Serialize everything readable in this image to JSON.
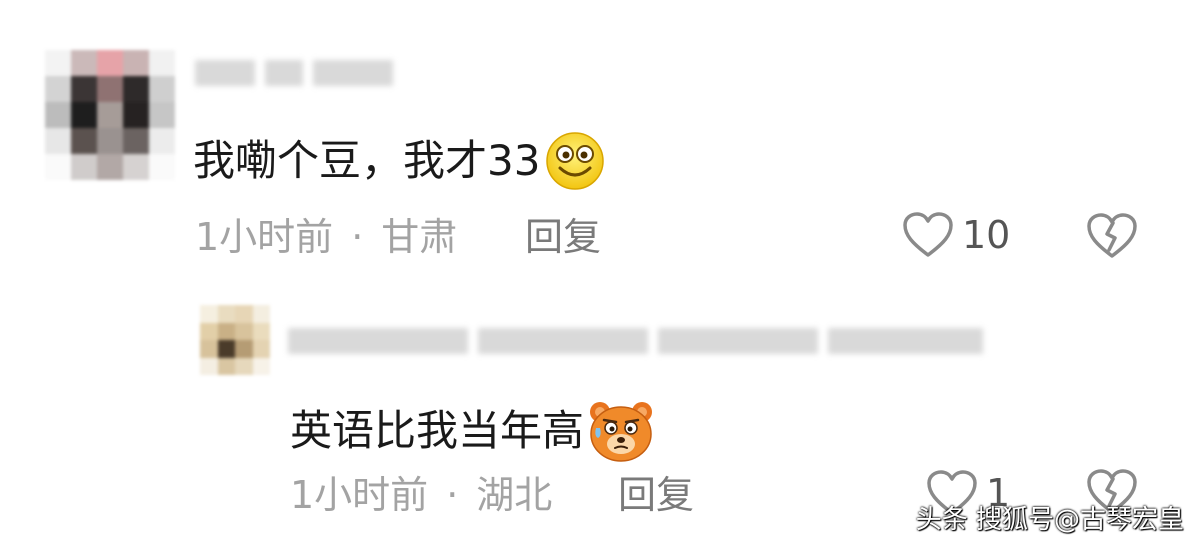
{
  "comments": [
    {
      "text": "我嘞个豆，我才33",
      "emoji": "smiley-face-icon",
      "time": "1小时前",
      "dot": "·",
      "location": "甘肃",
      "reply_label": "回复",
      "likes": "10"
    },
    {
      "text": "英语比我当年高",
      "emoji": "bear-face-icon",
      "time": "1小时前",
      "dot": "·",
      "location": "湖北",
      "reply_label": "回复",
      "likes": "1"
    }
  ],
  "watermark": "头条 搜狐号@古琴宏皇",
  "colors": {
    "meta": "#a3a3a3",
    "text": "#1a1a1a",
    "icon": "#8a8a8a"
  }
}
